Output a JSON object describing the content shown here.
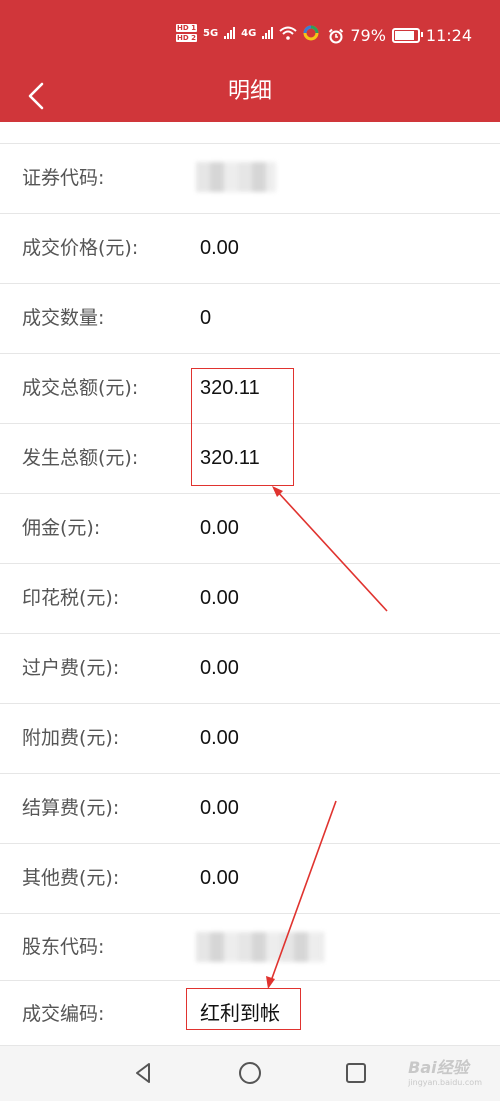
{
  "status_bar": {
    "hd1": "HD 1",
    "hd2": "HD 2",
    "net1": "5G",
    "net2": "4G",
    "battery_percent": "79%",
    "battery_level": 0.79,
    "time": "11:24",
    "icons": [
      "signal-icon",
      "wifi-icon",
      "app-icon",
      "alarm-icon",
      "battery-icon"
    ]
  },
  "header": {
    "title": "明细",
    "back_icon": "chevron-left-icon"
  },
  "details": [
    {
      "label": "证券代码:",
      "value": "",
      "blurred": true
    },
    {
      "label": "成交价格(元):",
      "value": "0.00"
    },
    {
      "label": "成交数量:",
      "value": "0"
    },
    {
      "label": "成交总额(元):",
      "value": "320.11"
    },
    {
      "label": "发生总额(元):",
      "value": "320.11"
    },
    {
      "label": "佣金(元):",
      "value": "0.00"
    },
    {
      "label": "印花税(元):",
      "value": "0.00"
    },
    {
      "label": "过户费(元):",
      "value": "0.00"
    },
    {
      "label": "附加费(元):",
      "value": "0.00"
    },
    {
      "label": "结算费(元):",
      "value": "0.00"
    },
    {
      "label": "其他费(元):",
      "value": "0.00"
    },
    {
      "label": "股东代码:",
      "value": "",
      "blurred": true
    },
    {
      "label": "成交编码:",
      "value": "红利到帐"
    }
  ],
  "nav_bar": {
    "icons": [
      "back-triangle-icon",
      "home-circle-icon",
      "recent-square-icon"
    ]
  },
  "watermark": {
    "text": "Bai经验",
    "sub": "jingyan.baidu.com"
  },
  "colors": {
    "brand": "#d0363a",
    "annotation": "#e0332f"
  }
}
